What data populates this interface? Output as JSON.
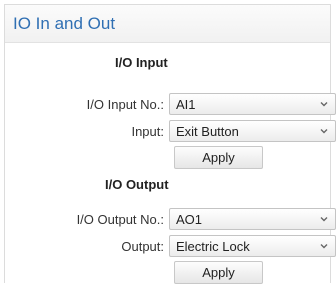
{
  "panel": {
    "title": "IO In and Out"
  },
  "io_input": {
    "section_title": "I/O Input",
    "input_no_label": "I/O Input No.:",
    "input_no_value": "AI1",
    "input_label": "Input:",
    "input_value": "Exit Button",
    "apply_label": "Apply"
  },
  "io_output": {
    "section_title": "I/O Output",
    "output_no_label": "I/O Output No.:",
    "output_no_value": "AO1",
    "output_label": "Output:",
    "output_value": "Electric Lock",
    "apply_label": "Apply"
  },
  "icons": {
    "dropdown": "chevron-down-icon"
  },
  "colors": {
    "title": "#2f6fb3"
  }
}
